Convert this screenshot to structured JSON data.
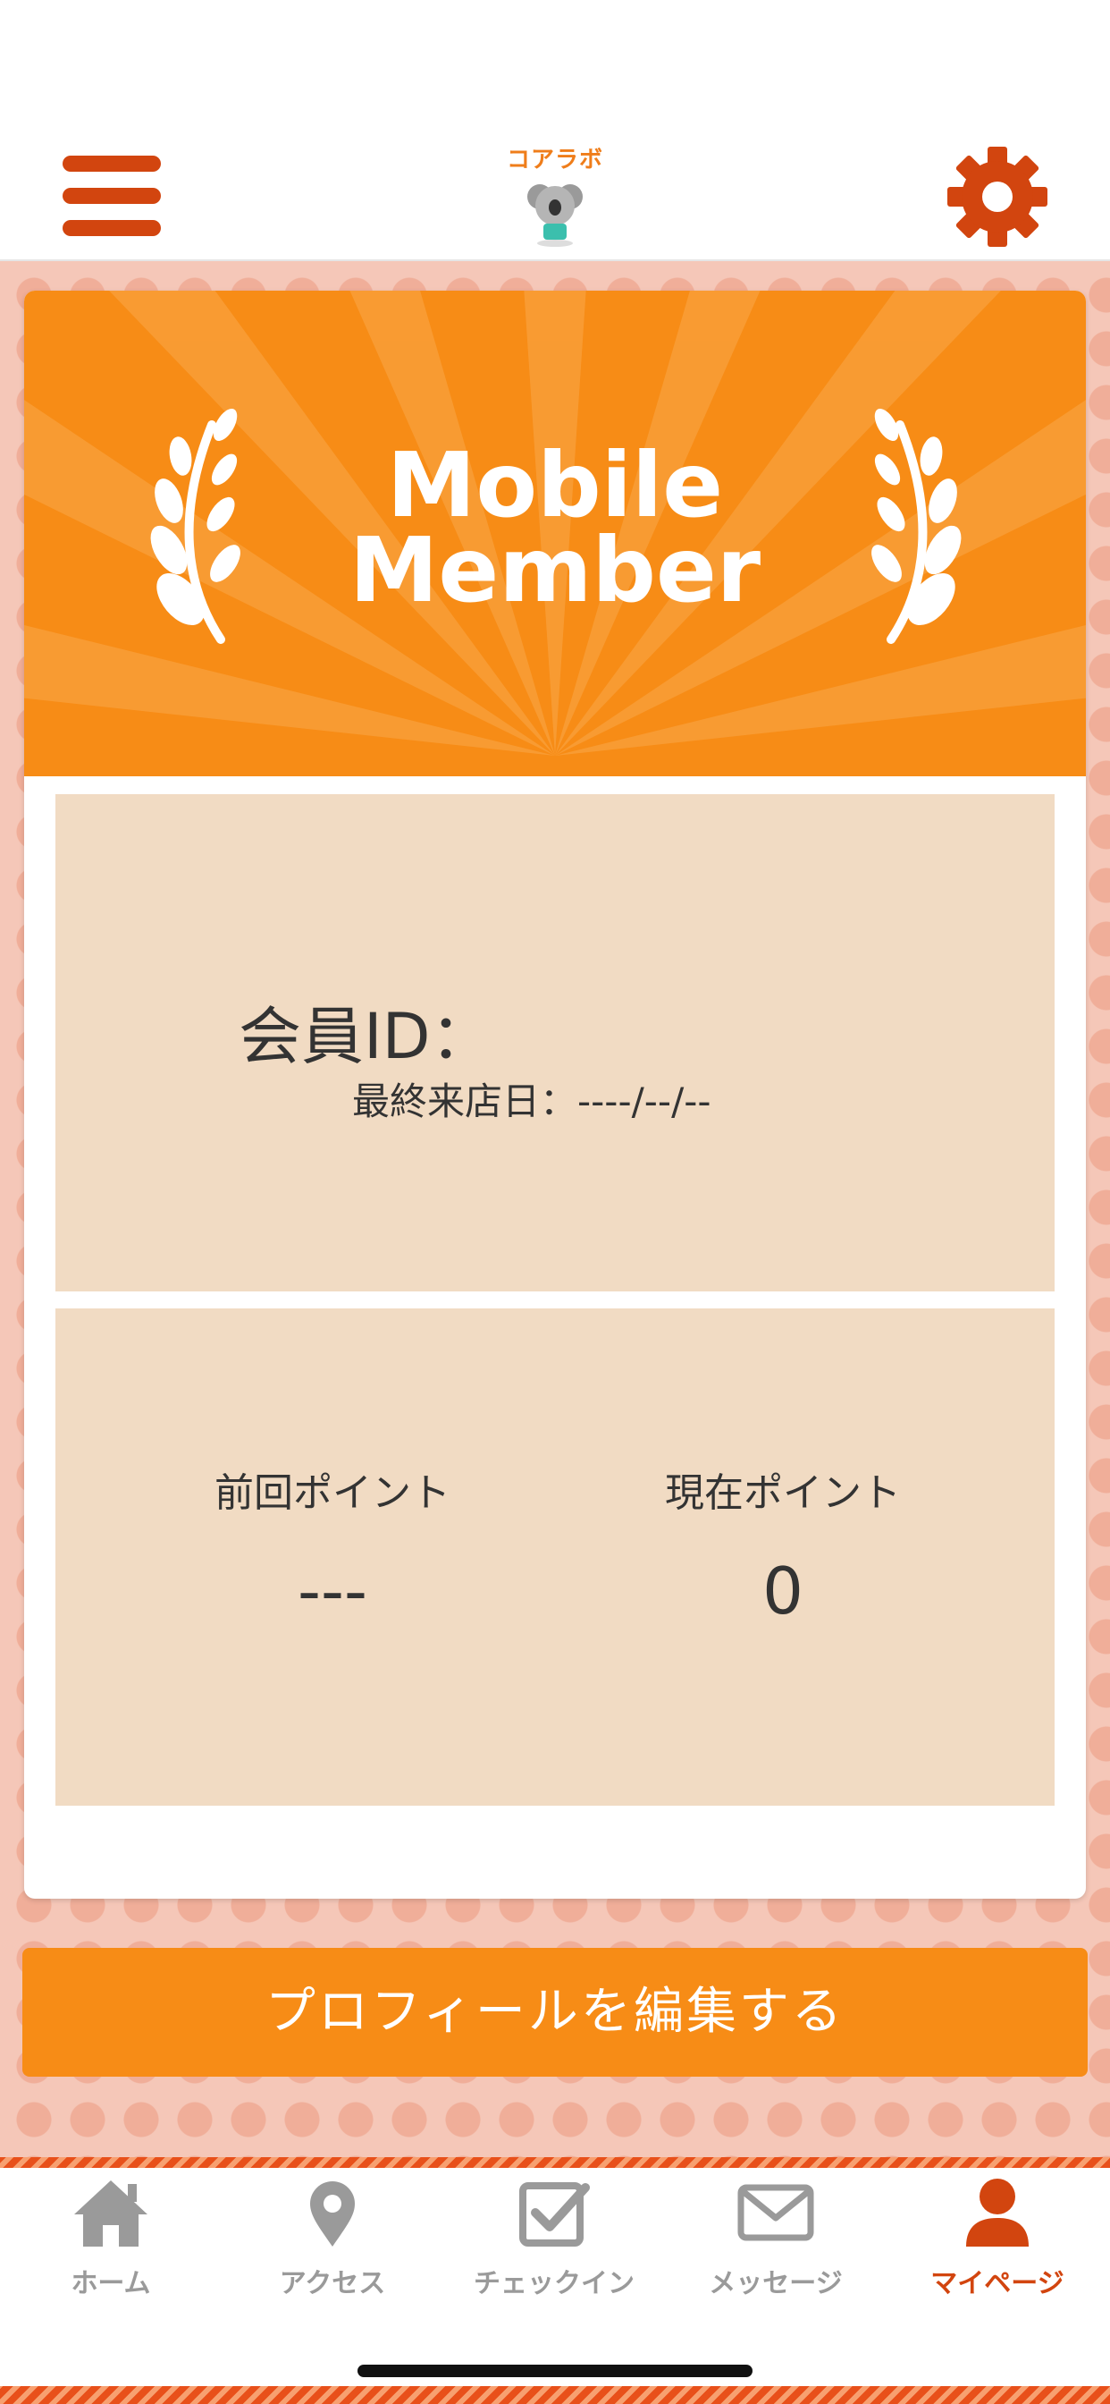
{
  "header": {
    "logo_text": "コアラボ",
    "menu_icon": "hamburger-menu-icon",
    "settings_icon": "gear-icon"
  },
  "banner": {
    "line1": "Mobile",
    "line2": "Member"
  },
  "member": {
    "id_label": "会員ID：",
    "last_visit": "最終来店日：----/--/--"
  },
  "points": {
    "previous_label": "前回ポイント",
    "previous_value": "---",
    "current_label": "現在ポイント",
    "current_value": "0"
  },
  "edit_button": "プロフィールを編集する",
  "tabs": [
    {
      "label": "ホーム",
      "icon": "home-icon",
      "active": false
    },
    {
      "label": "アクセス",
      "icon": "map-pin-icon",
      "active": false
    },
    {
      "label": "チェックイン",
      "icon": "checkbox-icon",
      "active": false
    },
    {
      "label": "メッセージ",
      "icon": "mail-icon",
      "active": false
    },
    {
      "label": "マイページ",
      "icon": "user-icon",
      "active": true
    }
  ],
  "colors": {
    "brand_orange": "#f78c16",
    "accent_red": "#d2450f",
    "panel_beige": "#f1dbc3",
    "inactive_gray": "#9a9a9a"
  }
}
